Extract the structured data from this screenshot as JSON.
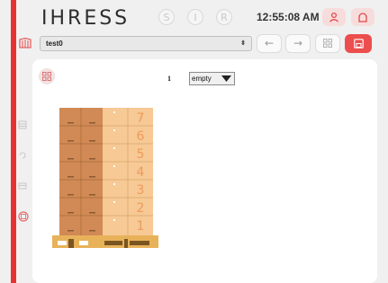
{
  "header": {
    "brand": "IHRESS",
    "mode_buttons": [
      "S",
      "I",
      "R"
    ],
    "clock": "12:55:08 AM"
  },
  "toolbar": {
    "product_select_value": "test0"
  },
  "main": {
    "layer_count": "1",
    "layer_select_value": "empty",
    "layer_labels": [
      "7",
      "6",
      "5",
      "4",
      "3",
      "2",
      "1"
    ]
  },
  "colors": {
    "accent": "#e8322f",
    "save_button": "#ec4e4e",
    "box_dark": "#d18a55",
    "box_light": "#f6c995",
    "pallet": "#e8b25a"
  },
  "icons": {
    "top_user": "user-icon",
    "top_home": "home-icon",
    "toolbar_left": "pallet-icon",
    "back": "arrow-left-icon",
    "forward": "arrow-right-icon",
    "grid": "grid-icon",
    "save": "save-icon"
  }
}
